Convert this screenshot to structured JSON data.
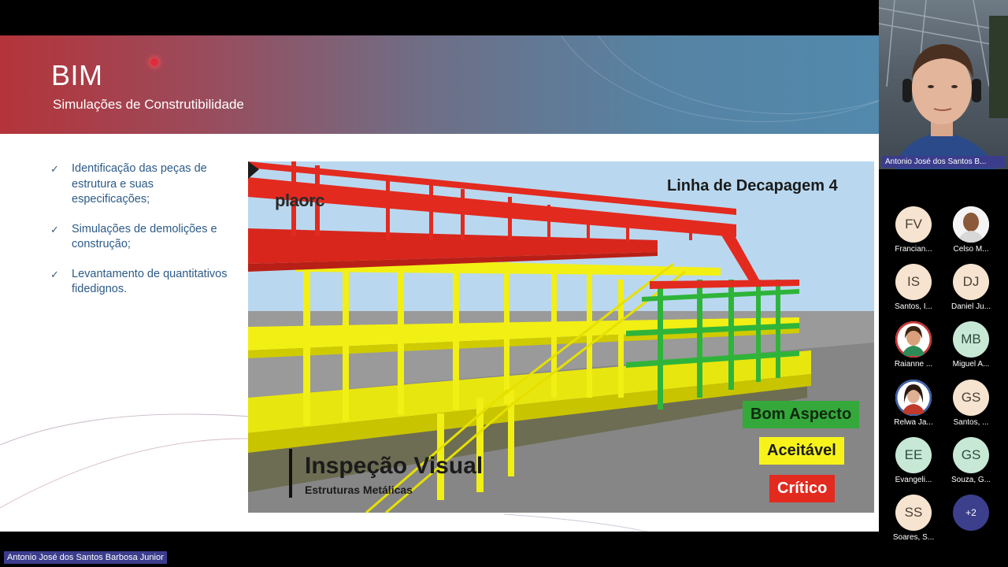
{
  "slide": {
    "title": "BIM",
    "subtitle": "Simulações de Construtibilidade",
    "bullets": [
      "Identificação das peças de estrutura e suas especificações;",
      "Simulações de demolições e construção;",
      "Levantamento de quantitativos fidedignos."
    ],
    "check_glyph": "✓"
  },
  "bim_image": {
    "title": "Linha de Decapagem 4",
    "logo": "plaorc",
    "inspection_title": "Inspeção Visual",
    "inspection_subtitle": "Estruturas Metálicas",
    "legend": {
      "good": "Bom Aspecto",
      "acceptable": "Aceitável",
      "critical": "Crítico"
    },
    "colors": {
      "good": "#35a83b",
      "acceptable": "#f7f31a",
      "critical": "#e32a1f"
    }
  },
  "presenter": {
    "name_full": "Antonio José dos Santos Barbosa Junior",
    "name_truncated": "Antonio José dos Santos B..."
  },
  "participants": [
    {
      "initials": "FV",
      "name": "Francian...",
      "type": "initials"
    },
    {
      "initials": "",
      "name": "Celso M...",
      "type": "photo"
    },
    {
      "initials": "IS",
      "name": "Santos, I...",
      "type": "initials"
    },
    {
      "initials": "DJ",
      "name": "Daniel Ju...",
      "type": "initials"
    },
    {
      "initials": "",
      "name": "Raianne ...",
      "type": "photo"
    },
    {
      "initials": "MB",
      "name": "Miguel A...",
      "type": "initials-green"
    },
    {
      "initials": "",
      "name": "Relwa Ja...",
      "type": "photo"
    },
    {
      "initials": "GS",
      "name": "Santos, ...",
      "type": "initials"
    },
    {
      "initials": "EE",
      "name": "Evangeli...",
      "type": "initials-green"
    },
    {
      "initials": "GS",
      "name": "Souza, G...",
      "type": "initials-green"
    },
    {
      "initials": "SS",
      "name": "Soares, S...",
      "type": "initials"
    },
    {
      "initials": "+2",
      "name": "",
      "type": "more"
    }
  ]
}
